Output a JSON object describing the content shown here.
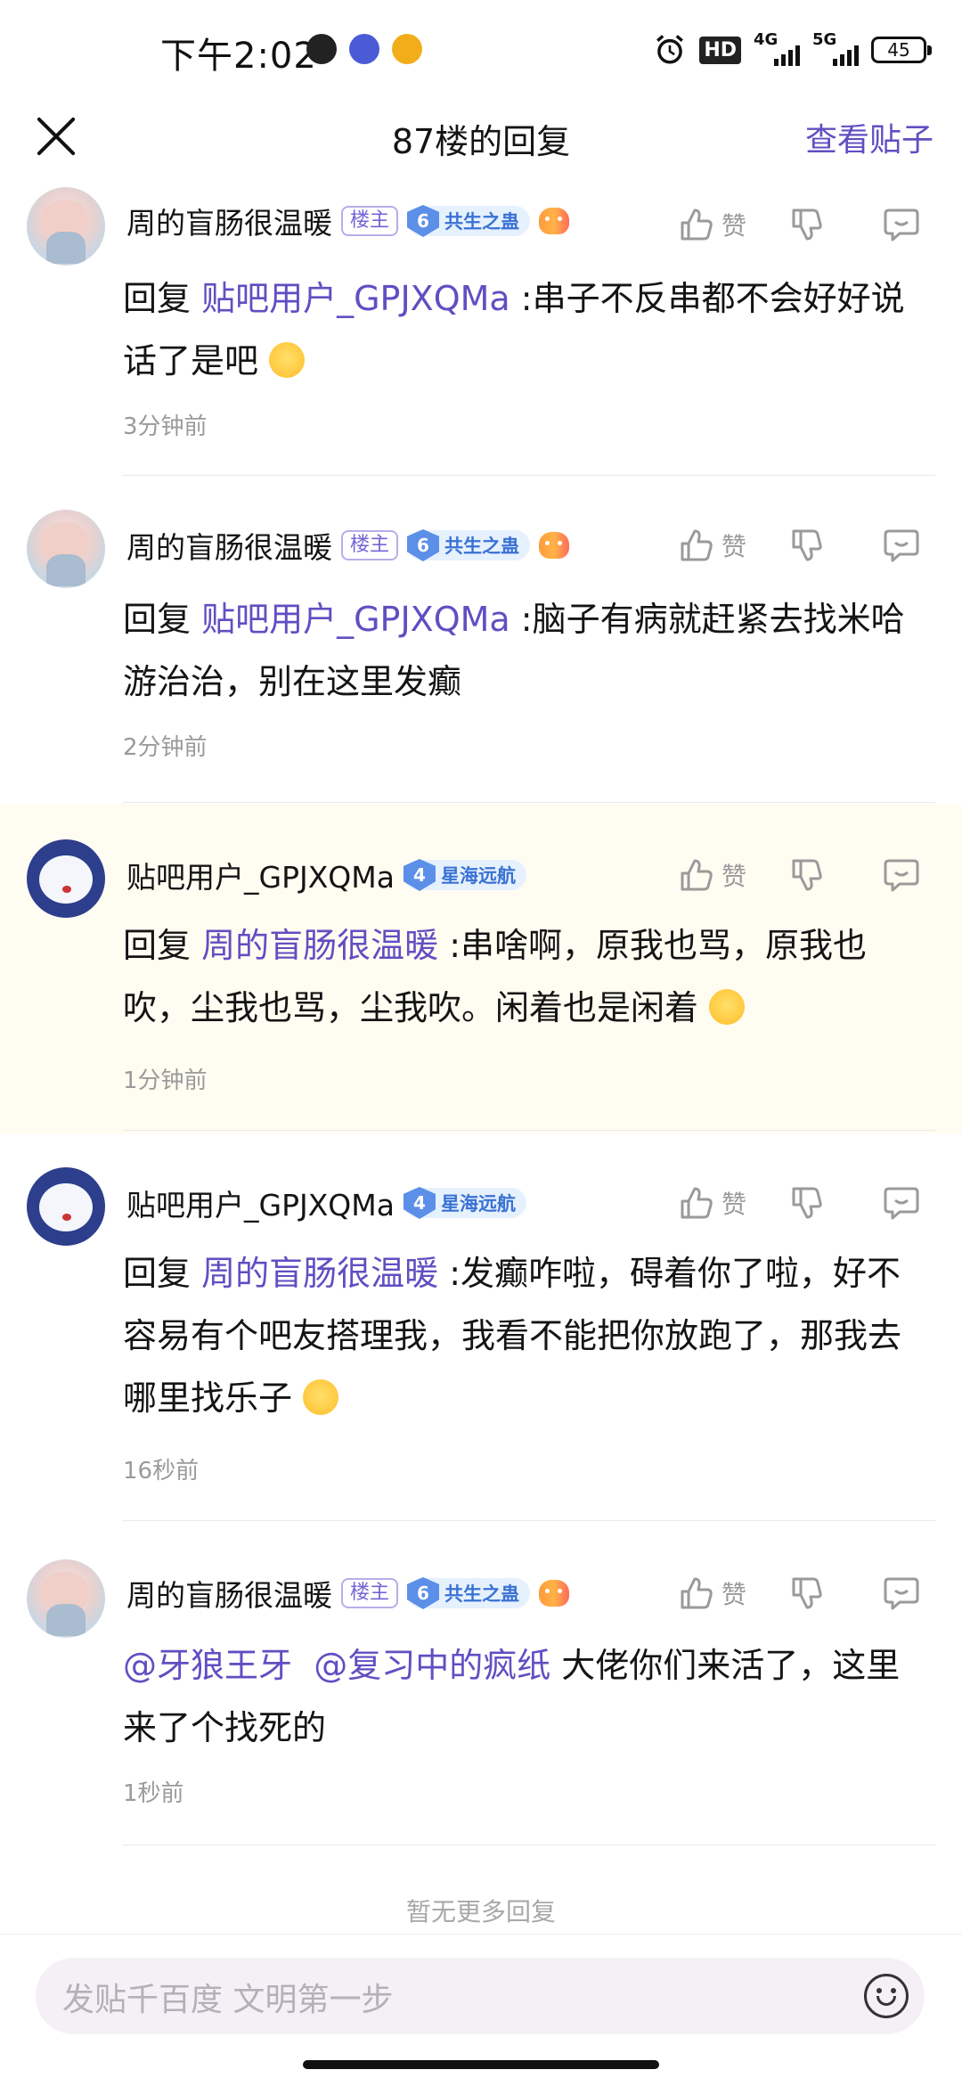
{
  "status_bar": {
    "time": "下午2:02",
    "hd": "HD",
    "net1": "4G",
    "net2": "5G",
    "battery": "45"
  },
  "header": {
    "close_icon": "close-icon",
    "title": "87楼的回复",
    "view_post": "查看贴子"
  },
  "comments": [
    {
      "username": "周的盲肠很温暖",
      "owner_tag": "楼主",
      "level": "6",
      "level_name": "共生之蛊",
      "like_label": "赞",
      "reply_prefix": "回复",
      "mention": "贴吧用户_GPJXQMa",
      "text": " :串子不反串都不会好好说话了是吧",
      "time": "3分钟前"
    },
    {
      "username": "周的盲肠很温暖",
      "owner_tag": "楼主",
      "level": "6",
      "level_name": "共生之蛊",
      "like_label": "赞",
      "reply_prefix": "回复",
      "mention": "贴吧用户_GPJXQMa",
      "text": " :脑子有病就赶紧去找米哈游治治，别在这里发癫",
      "time": "2分钟前"
    },
    {
      "username": "贴吧用户_GPJXQMa",
      "level": "4",
      "level_name": "星海远航",
      "like_label": "赞",
      "reply_prefix": "回复",
      "mention": "周的盲肠很温暖",
      "text": " :串啥啊，原我也骂，原我也吹，尘我也骂，尘我吹。闲着也是闲着",
      "time": "1分钟前"
    },
    {
      "username": "贴吧用户_GPJXQMa",
      "level": "4",
      "level_name": "星海远航",
      "like_label": "赞",
      "reply_prefix": "回复",
      "mention": "周的盲肠很温暖",
      "text": " :发癫咋啦，碍着你了啦，好不容易有个吧友搭理我，我看不能把你放跑了，那我去哪里找乐子",
      "time": "16秒前"
    },
    {
      "username": "周的盲肠很温暖",
      "owner_tag": "楼主",
      "level": "6",
      "level_name": "共生之蛊",
      "like_label": "赞",
      "mention_a": "@牙狼王牙",
      "mention_b": "@复习中的疯纸",
      "text": " 大佬你们来活了，这里来了个找死的",
      "time": "1秒前"
    }
  ],
  "footer": {
    "no_more": "暂无更多回复",
    "input_placeholder": "发贴千百度 文明第一步"
  },
  "colors": {
    "accent": "#614ec2",
    "level_blue": "#3a72d4",
    "highlight_bg": "#fffdf2"
  }
}
